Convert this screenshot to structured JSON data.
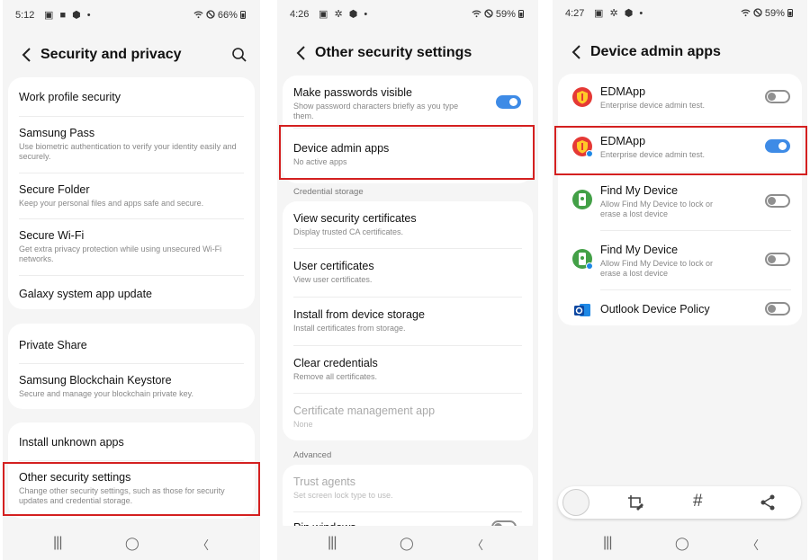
{
  "panel1": {
    "time": "5:12",
    "status_icons": "▣ ■ ⬢ •",
    "status_right": "66%",
    "title": "Security and privacy",
    "items": [
      {
        "title": "Work profile security",
        "sub": ""
      },
      {
        "title": "Samsung Pass",
        "sub": "Use biometric authentication to verify your identity easily and securely."
      },
      {
        "title": "Secure Folder",
        "sub": "Keep your personal files and apps safe and secure."
      },
      {
        "title": "Secure Wi-Fi",
        "sub": "Get extra privacy protection while using unsecured Wi-Fi networks."
      },
      {
        "title": "Galaxy system app update",
        "sub": ""
      },
      {
        "title": "Private Share",
        "sub": ""
      },
      {
        "title": "Samsung Blockchain Keystore",
        "sub": "Secure and manage your blockchain private key."
      },
      {
        "title": "Install unknown apps",
        "sub": ""
      },
      {
        "title": "Other security settings",
        "sub": "Change other security settings, such as those for security updates and credential storage."
      }
    ]
  },
  "panel2": {
    "time": "4:26",
    "status_icons": "▣ ✲ ⬢ •",
    "status_right": "59%",
    "title": "Other security settings",
    "make_passwords": {
      "title": "Make passwords visible",
      "sub": "Show password characters briefly as you type them."
    },
    "device_admin": {
      "title": "Device admin apps",
      "sub": "No active apps"
    },
    "credential_section": "Credential storage",
    "credentials": [
      {
        "title": "View security certificates",
        "sub": "Display trusted CA certificates."
      },
      {
        "title": "User certificates",
        "sub": "View user certificates."
      },
      {
        "title": "Install from device storage",
        "sub": "Install certificates from storage."
      },
      {
        "title": "Clear credentials",
        "sub": "Remove all certificates."
      },
      {
        "title": "Certificate management app",
        "sub": "None"
      }
    ],
    "advanced_section": "Advanced",
    "trust_agents": {
      "title": "Trust agents",
      "sub": "Set screen lock type to use."
    },
    "partial_item": "Pin windows"
  },
  "panel3": {
    "time": "4:27",
    "status_icons": "▣ ✲ ⬢ •",
    "status_right": "59%",
    "title": "Device admin apps",
    "apps": [
      {
        "title": "EDMApp",
        "sub": "Enterprise device admin test.",
        "enabled": false
      },
      {
        "title": "EDMApp",
        "sub": "Enterprise device admin test.",
        "enabled": true
      },
      {
        "title": "Find My Device",
        "sub": "Allow Find My Device to lock or erase a lost device",
        "enabled": false
      },
      {
        "title": "Find My Device",
        "sub": "Allow Find My Device to lock or erase a lost device",
        "enabled": false
      },
      {
        "title": "Outlook Device Policy",
        "sub": "",
        "enabled": false
      }
    ]
  },
  "nav": {
    "recents": "|||",
    "home": "◯",
    "back": "〈"
  },
  "colors": {
    "accent": "#3e8be6",
    "highlight": "#d42020"
  }
}
